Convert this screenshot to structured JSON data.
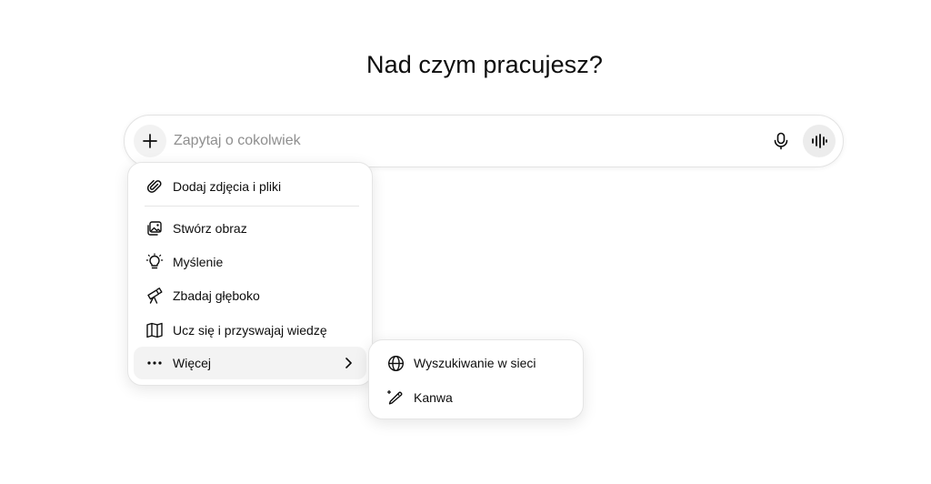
{
  "main": {
    "heading": "Nad czym pracujesz?"
  },
  "composer": {
    "placeholder": "Zapytaj o cokolwiek",
    "value": "",
    "icons": {
      "add": "plus-icon",
      "dictate": "microphone-icon",
      "voice_mode": "voice-waveform-icon"
    }
  },
  "menu": {
    "items": [
      {
        "label": "Dodaj zdjęcia i pliki",
        "icon": "paperclip-icon"
      },
      {
        "label": "Stwórz obraz",
        "icon": "image-icon"
      },
      {
        "label": "Myślenie",
        "icon": "lightbulb-icon"
      },
      {
        "label": "Zbadaj głęboko",
        "icon": "telescope-icon"
      },
      {
        "label": "Ucz się i przyswajaj wiedzę",
        "icon": "book-icon"
      },
      {
        "label": "Więcej",
        "icon": "more-dots-icon",
        "active": true
      }
    ]
  },
  "submenu": {
    "items": [
      {
        "label": "Wyszukiwanie w sieci",
        "icon": "globe-icon"
      },
      {
        "label": "Kanwa",
        "icon": "canvas-pen-icon"
      }
    ]
  },
  "colors": {
    "text": "#0d0d0d",
    "placeholder": "#8f8f8f",
    "border": "#e5e5e5",
    "hover": "#f3f3f3",
    "button_bg": "#f2f2f2"
  }
}
